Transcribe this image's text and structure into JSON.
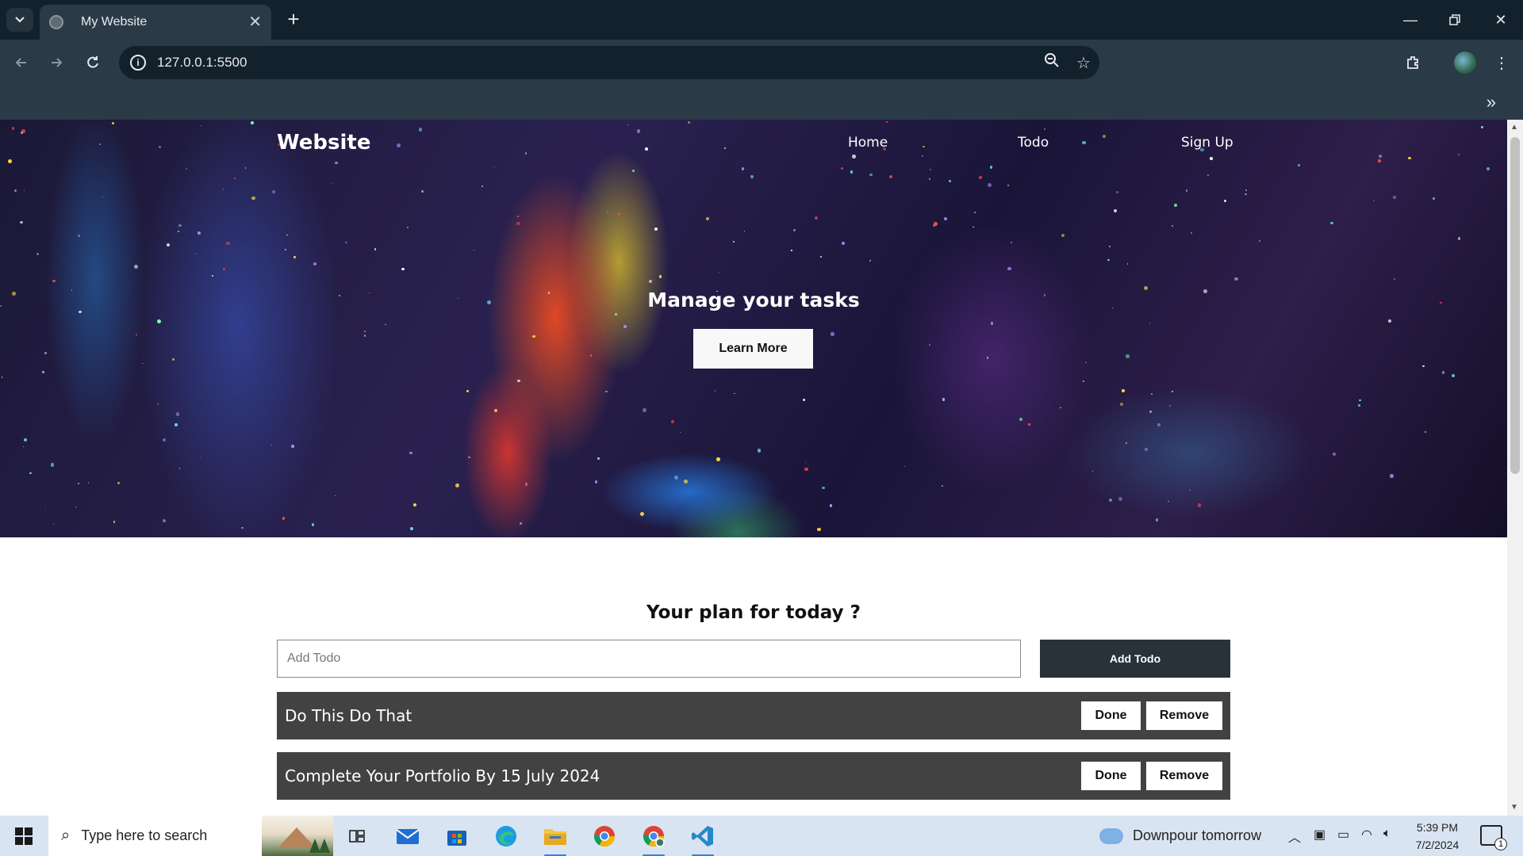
{
  "browser": {
    "tab_title": "My Website",
    "url": "127.0.0.1:5500"
  },
  "site": {
    "brand": "Website",
    "nav": [
      {
        "label": "Home"
      },
      {
        "label": "Todo"
      },
      {
        "label": "Sign Up"
      }
    ],
    "hero_title": "Manage your tasks",
    "learn_more_label": "Learn More"
  },
  "todo": {
    "heading": "Your plan for today ?",
    "input_placeholder": "Add Todo",
    "input_value": "",
    "add_label": "Add Todo",
    "items": [
      {
        "text": "Do This Do That",
        "done_label": "Done",
        "remove_label": "Remove"
      },
      {
        "text": "Complete Your Portfolio By 15 July 2024",
        "done_label": "Done",
        "remove_label": "Remove"
      }
    ]
  },
  "taskbar": {
    "search_placeholder": "Type here to search",
    "weather": "Downpour tomorrow",
    "time": "5:39 PM",
    "date": "7/2/2024",
    "notification_count": "1",
    "apps": [
      "task-view-icon",
      "mail-icon",
      "store-icon",
      "edge-icon",
      "file-explorer-icon",
      "chrome-icon",
      "chrome-profile-icon",
      "vscode-icon"
    ]
  },
  "colors": {
    "browser_dark": "#13212d",
    "browser_toolbar": "#2a3a47",
    "todo_row": "#424242",
    "add_button": "#27323a",
    "taskbar": "#d9e4f2"
  }
}
